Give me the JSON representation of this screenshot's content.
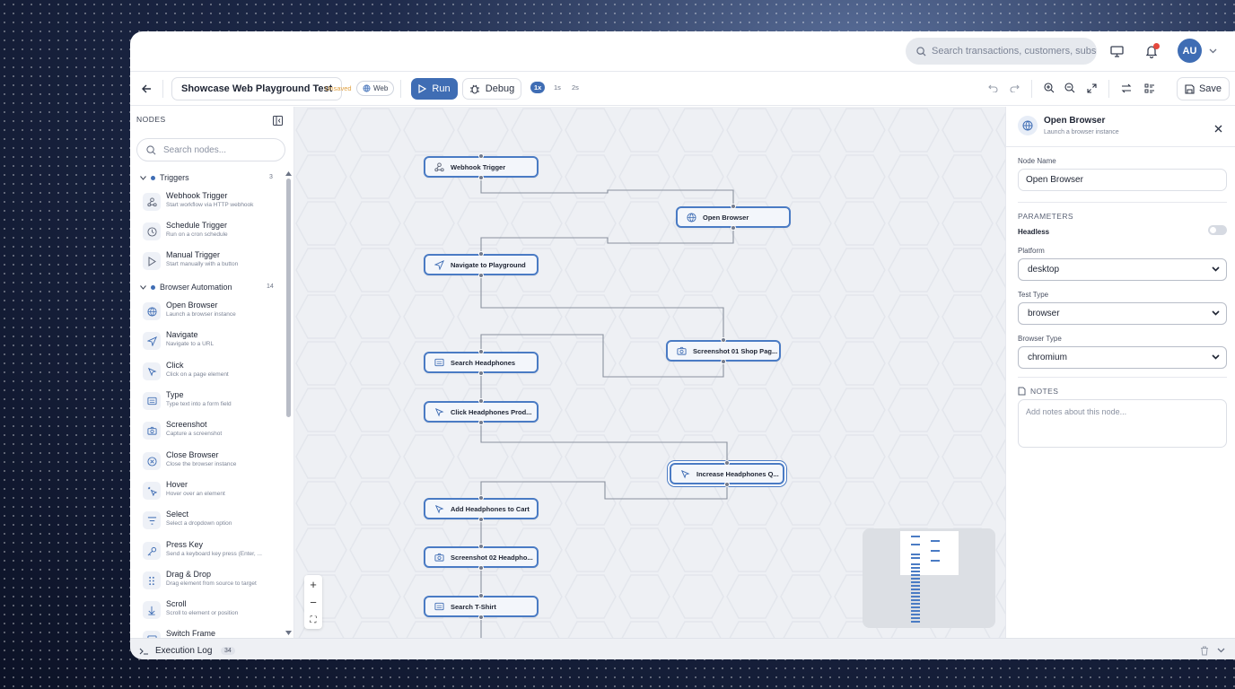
{
  "header": {
    "search_placeholder": "Search transactions, customers, subs",
    "avatar_initials": "AU"
  },
  "toolbar": {
    "title": "Showcase Web Playground Test",
    "unsaved": "Unsaved",
    "platform_pill": "Web",
    "run_label": "Run",
    "debug_label": "Debug",
    "speeds": [
      "1x",
      "1s",
      "2s"
    ],
    "save_label": "Save"
  },
  "sidebar": {
    "header": "NODES",
    "search_placeholder": "Search nodes...",
    "categories": [
      {
        "label": "Triggers",
        "count": "3"
      },
      {
        "label": "Browser Automation",
        "count": "14"
      }
    ],
    "items": [
      {
        "name": "Webhook Trigger",
        "desc": "Start workflow via HTTP webhook",
        "icon": "webhook-icon"
      },
      {
        "name": "Schedule Trigger",
        "desc": "Run on a cron schedule",
        "icon": "clock-icon"
      },
      {
        "name": "Manual Trigger",
        "desc": "Start manually with a button",
        "icon": "play-icon"
      },
      {
        "name": "Open Browser",
        "desc": "Launch a browser instance",
        "icon": "globe-icon"
      },
      {
        "name": "Navigate",
        "desc": "Navigate to a URL",
        "icon": "navigation-icon"
      },
      {
        "name": "Click",
        "desc": "Click on a page element",
        "icon": "pointer-icon"
      },
      {
        "name": "Type",
        "desc": "Type text into a form field",
        "icon": "keyboard-icon"
      },
      {
        "name": "Screenshot",
        "desc": "Capture a screenshot",
        "icon": "camera-icon"
      },
      {
        "name": "Close Browser",
        "desc": "Close the browser instance",
        "icon": "close-circle-icon"
      },
      {
        "name": "Hover",
        "desc": "Hover over an element",
        "icon": "hover-icon"
      },
      {
        "name": "Select",
        "desc": "Select a dropdown option",
        "icon": "filter-icon"
      },
      {
        "name": "Press Key",
        "desc": "Send a keyboard key press (Enter, ...",
        "icon": "key-icon"
      },
      {
        "name": "Drag & Drop",
        "desc": "Drag element from source to target",
        "icon": "drag-icon"
      },
      {
        "name": "Scroll",
        "desc": "Scroll to element or position",
        "icon": "scroll-icon"
      },
      {
        "name": "Switch Frame",
        "desc": "",
        "icon": "frame-icon"
      }
    ]
  },
  "canvas": {
    "nodes": [
      {
        "label": "Webhook Trigger",
        "icon": "webhook-icon"
      },
      {
        "label": "Open Browser",
        "icon": "globe-icon"
      },
      {
        "label": "Navigate to Playground",
        "icon": "navigation-icon"
      },
      {
        "label": "Screenshot 01 Shop Pag...",
        "icon": "camera-icon"
      },
      {
        "label": "Search Headphones",
        "icon": "keyboard-icon"
      },
      {
        "label": "Click Headphones Prod...",
        "icon": "pointer-icon"
      },
      {
        "label": "Increase Headphones Q...",
        "icon": "pointer-icon"
      },
      {
        "label": "Add Headphones to Cart",
        "icon": "pointer-icon"
      },
      {
        "label": "Screenshot 02 Headpho...",
        "icon": "camera-icon"
      },
      {
        "label": "Search T-Shirt",
        "icon": "keyboard-icon"
      }
    ],
    "zoom_controls": [
      "+",
      "−",
      "⛶"
    ]
  },
  "panel": {
    "title": "Open Browser",
    "subtitle": "Launch a browser instance",
    "node_name_label": "Node Name",
    "node_name_value": "Open Browser",
    "parameters_label": "PARAMETERS",
    "headless_label": "Headless",
    "headless_on": false,
    "platform_label": "Platform",
    "platform_value": "desktop",
    "test_type_label": "Test Type",
    "test_type_value": "browser",
    "browser_type_label": "Browser Type",
    "browser_type_value": "chromium",
    "notes_label": "NOTES",
    "notes_placeholder": "Add notes about this node..."
  },
  "execlog": {
    "title": "Execution Log",
    "count": "34"
  },
  "colors": {
    "accent": "#3f6db4",
    "node_border": "#4a7bc4",
    "notification": "#e5483d",
    "unsaved": "#e0a040"
  }
}
